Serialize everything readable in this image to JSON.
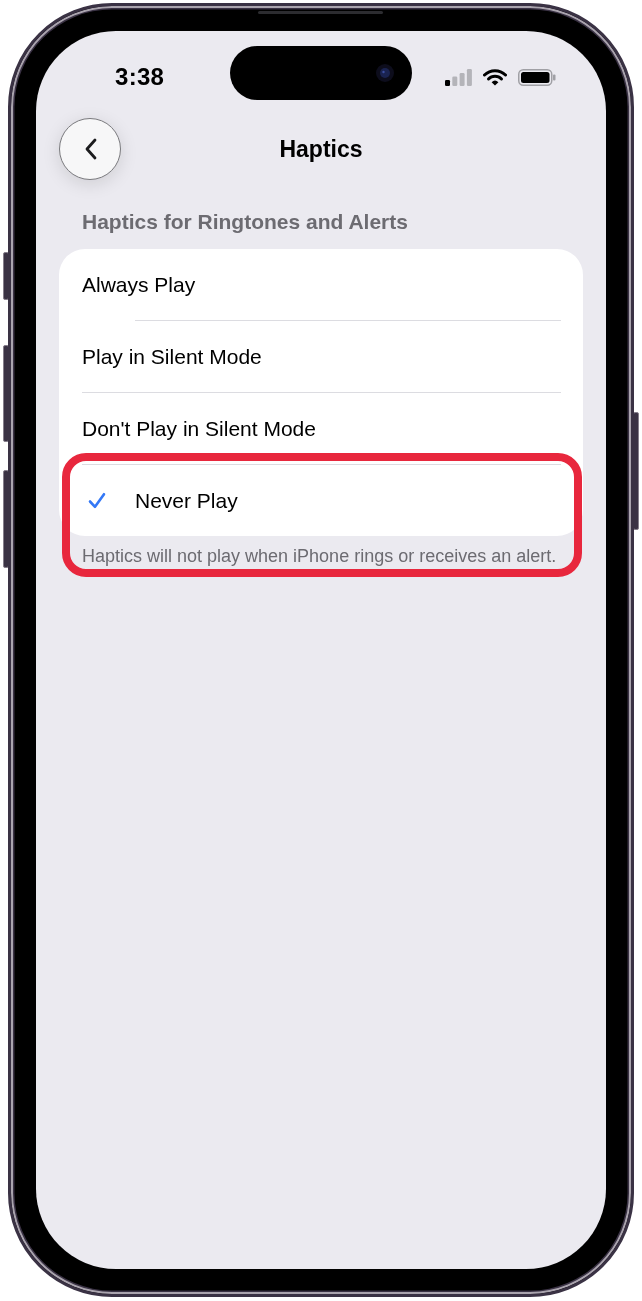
{
  "status_bar": {
    "time": "3:38"
  },
  "nav": {
    "title": "Haptics"
  },
  "section": {
    "header": "Haptics for Ringtones and Alerts",
    "options": [
      {
        "label": "Always Play",
        "selected": false
      },
      {
        "label": "Play in Silent Mode",
        "selected": false
      },
      {
        "label": "Don't Play in Silent Mode",
        "selected": false
      },
      {
        "label": "Never Play",
        "selected": true
      }
    ],
    "footer": "Haptics will not play when iPhone rings or receives an alert."
  },
  "highlight_frame": true
}
